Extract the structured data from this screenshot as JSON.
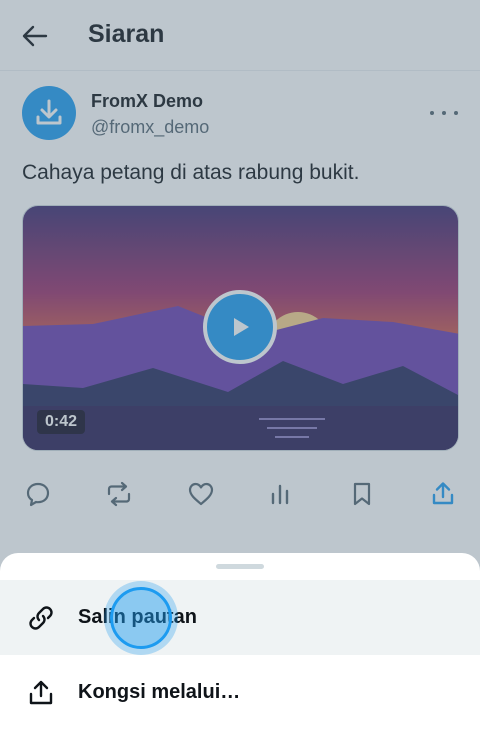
{
  "header": {
    "title": "Siaran"
  },
  "post": {
    "author_name": "FromX Demo",
    "author_handle": "@fromx_demo",
    "text": "Cahaya petang di atas rabung bukit.",
    "video_duration": "0:42"
  },
  "actions": [
    "reply-icon",
    "repost-icon",
    "like-icon",
    "views-icon",
    "bookmark-icon",
    "share-icon"
  ],
  "sheet": {
    "items": [
      {
        "label": "Salin pautan",
        "icon": "link-icon"
      },
      {
        "label": "Kongsi melalui…",
        "icon": "share-icon"
      }
    ]
  },
  "colors": {
    "accent": "#1d9bf0",
    "text": "#0f1419",
    "secondary": "#536471",
    "scrim": "rgba(91,112,131,0.40)"
  }
}
